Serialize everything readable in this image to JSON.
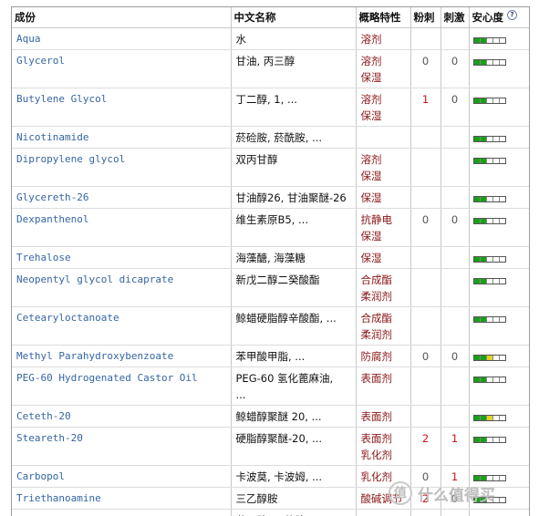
{
  "headers": [
    "成份",
    "中文名称",
    "概略特性",
    "粉刺",
    "刺激",
    "安心度"
  ],
  "help_glyph": "?",
  "rows": [
    {
      "name": "Aqua",
      "cn": "水",
      "func": "溶剂",
      "acne": "",
      "irr": "",
      "safe": "green"
    },
    {
      "name": "Glycerol",
      "cn": "甘油, 丙三醇",
      "func": "溶剂\n保湿",
      "acne": "0",
      "irr": "0",
      "safe": "green"
    },
    {
      "name": "Butylene Glycol",
      "cn": "丁二醇, 1, ...",
      "func": "溶剂\n保湿",
      "acne": "1",
      "irr": "0",
      "safe": "green"
    },
    {
      "name": "Nicotinamide",
      "cn": "菸硷胺, 菸酰胺, ...",
      "func": "",
      "acne": "",
      "irr": "",
      "safe": "green"
    },
    {
      "name": "Dipropylene glycol",
      "cn": "双丙甘醇",
      "func": "溶剂\n保湿",
      "acne": "",
      "irr": "",
      "safe": "green"
    },
    {
      "name": "Glycereth-26",
      "cn": "甘油醇26, 甘油聚醚-26",
      "func": "保湿",
      "acne": "",
      "irr": "",
      "safe": "green"
    },
    {
      "name": "Dexpanthenol",
      "cn": "维生素原B5, ...",
      "func": "抗静电\n保湿",
      "acne": "0",
      "irr": "0",
      "safe": "green"
    },
    {
      "name": "Trehalose",
      "cn": "海藻醣, 海藻糖",
      "func": "保湿",
      "acne": "",
      "irr": "",
      "safe": "green"
    },
    {
      "name": "Neopentyl glycol dicaprate",
      "cn": "新戊二醇二癸酸酯",
      "func": "合成酯\n柔润剂",
      "acne": "",
      "irr": "",
      "safe": "green"
    },
    {
      "name": "Cetearyloctanoate",
      "cn": "鲸蜡硬脂醇辛酸酯, ...",
      "func": "合成酯\n柔润剂",
      "acne": "",
      "irr": "",
      "safe": "green"
    },
    {
      "name": "Methyl Parahydroxybenzoate",
      "cn": "苯甲酸甲脂, ...",
      "func": "防腐剂",
      "acne": "0",
      "irr": "0",
      "safe": "yellow"
    },
    {
      "name": "PEG-60 Hydrogenated Castor Oil",
      "cn": "PEG-60 氢化蓖麻油,\n...",
      "func": "表面剂",
      "acne": "",
      "irr": "",
      "safe": "green"
    },
    {
      "name": "Ceteth-20",
      "cn": "鲸蜡醇聚醚 20, ...",
      "func": "表面剂",
      "acne": "",
      "irr": "",
      "safe": "yellow"
    },
    {
      "name": "Steareth-20",
      "cn": "硬脂醇聚醚-20, ...",
      "func": "表面剂\n乳化剂",
      "acne": "2",
      "irr": "1",
      "safe": "green"
    },
    {
      "name": "Carbopol",
      "cn": "卡波莫, 卡波姆, ...",
      "func": "乳化剂",
      "acne": "0",
      "irr": "1",
      "safe": "green"
    },
    {
      "name": "Triethanoamine",
      "cn": "三乙醇胺",
      "func": "酸碱调节",
      "acne": "2",
      "irr": "0",
      "safe": "green"
    },
    {
      "name": "Xantham Gum",
      "cn": "黄原胶, 三仙胶, ...",
      "func": "",
      "acne": "",
      "irr": "",
      "safe": "green"
    }
  ],
  "watermark": "什么值得买",
  "watermark_logo": "值"
}
